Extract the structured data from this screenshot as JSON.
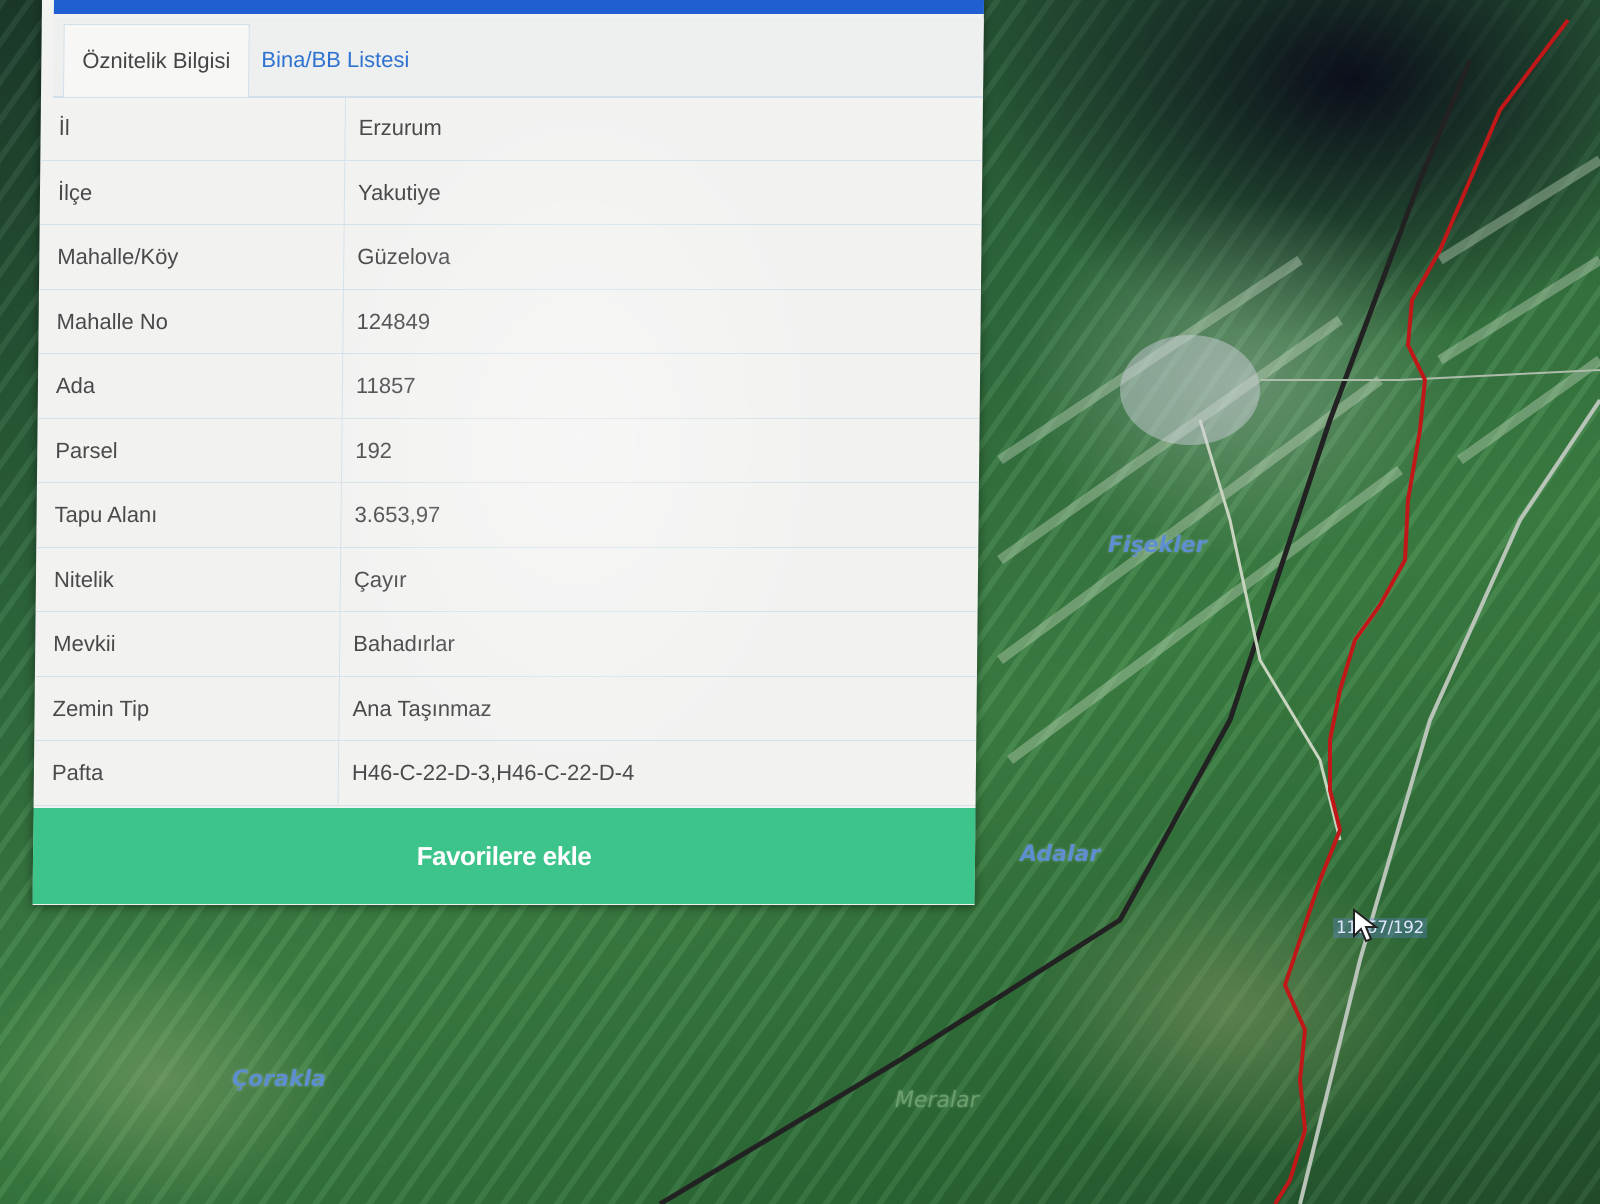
{
  "tabs": [
    {
      "label": "Öznitelik Bilgisi"
    },
    {
      "label": "Bina/BB Listesi"
    }
  ],
  "attributes": [
    {
      "key": "İl",
      "value": "Erzurum"
    },
    {
      "key": "İlçe",
      "value": "Yakutiye"
    },
    {
      "key": "Mahalle/Köy",
      "value": "Güzelova"
    },
    {
      "key": "Mahalle No",
      "value": "124849"
    },
    {
      "key": "Ada",
      "value": "11857"
    },
    {
      "key": "Parsel",
      "value": "192"
    },
    {
      "key": "Tapu Alanı",
      "value": "3.653,97"
    },
    {
      "key": "Nitelik",
      "value": "Çayır"
    },
    {
      "key": "Mevkii",
      "value": "Bahadırlar"
    },
    {
      "key": "Zemin Tip",
      "value": "Ana Taşınmaz"
    },
    {
      "key": "Pafta",
      "value": "H46-C-22-D-3,H46-C-22-D-4"
    }
  ],
  "favorite_button": {
    "label": "Favorilere ekle"
  },
  "map": {
    "place_labels": [
      "Fişekler",
      "Adalar",
      "Çorakla",
      "Meralar"
    ],
    "parcel_label": "11857/192",
    "colors": {
      "parcel_boundary": "#c01818",
      "place_label": "#5d8fd0",
      "accent": "#3cc48a",
      "header": "#1f5fd2"
    }
  }
}
